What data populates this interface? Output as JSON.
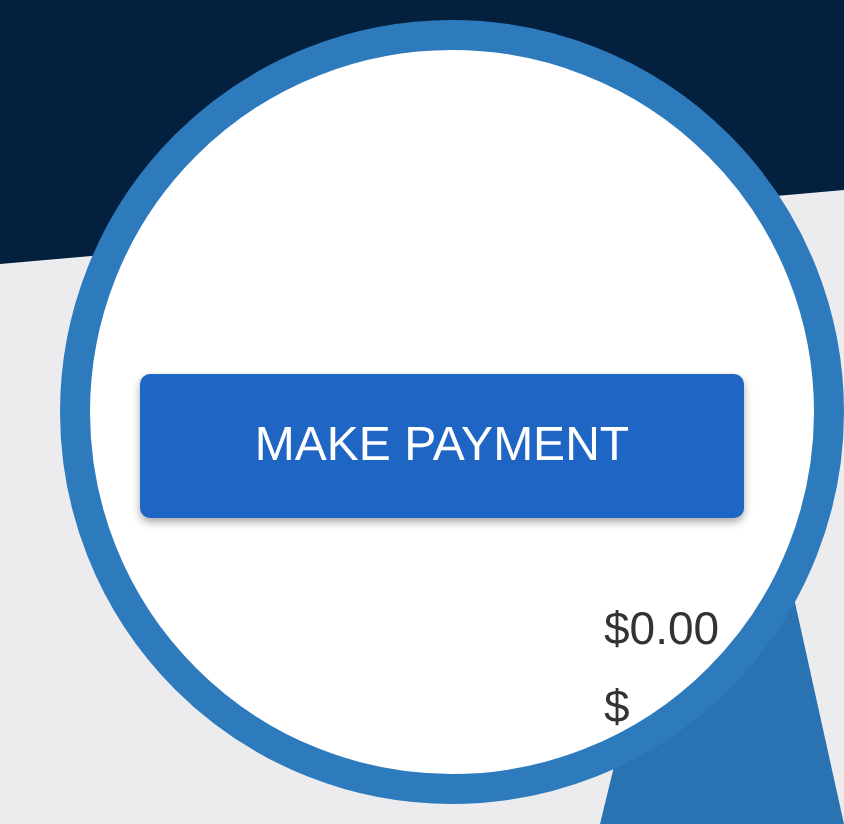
{
  "button": {
    "label": "MAKE PAYMENT"
  },
  "amounts": [
    "$0.00",
    "$"
  ]
}
